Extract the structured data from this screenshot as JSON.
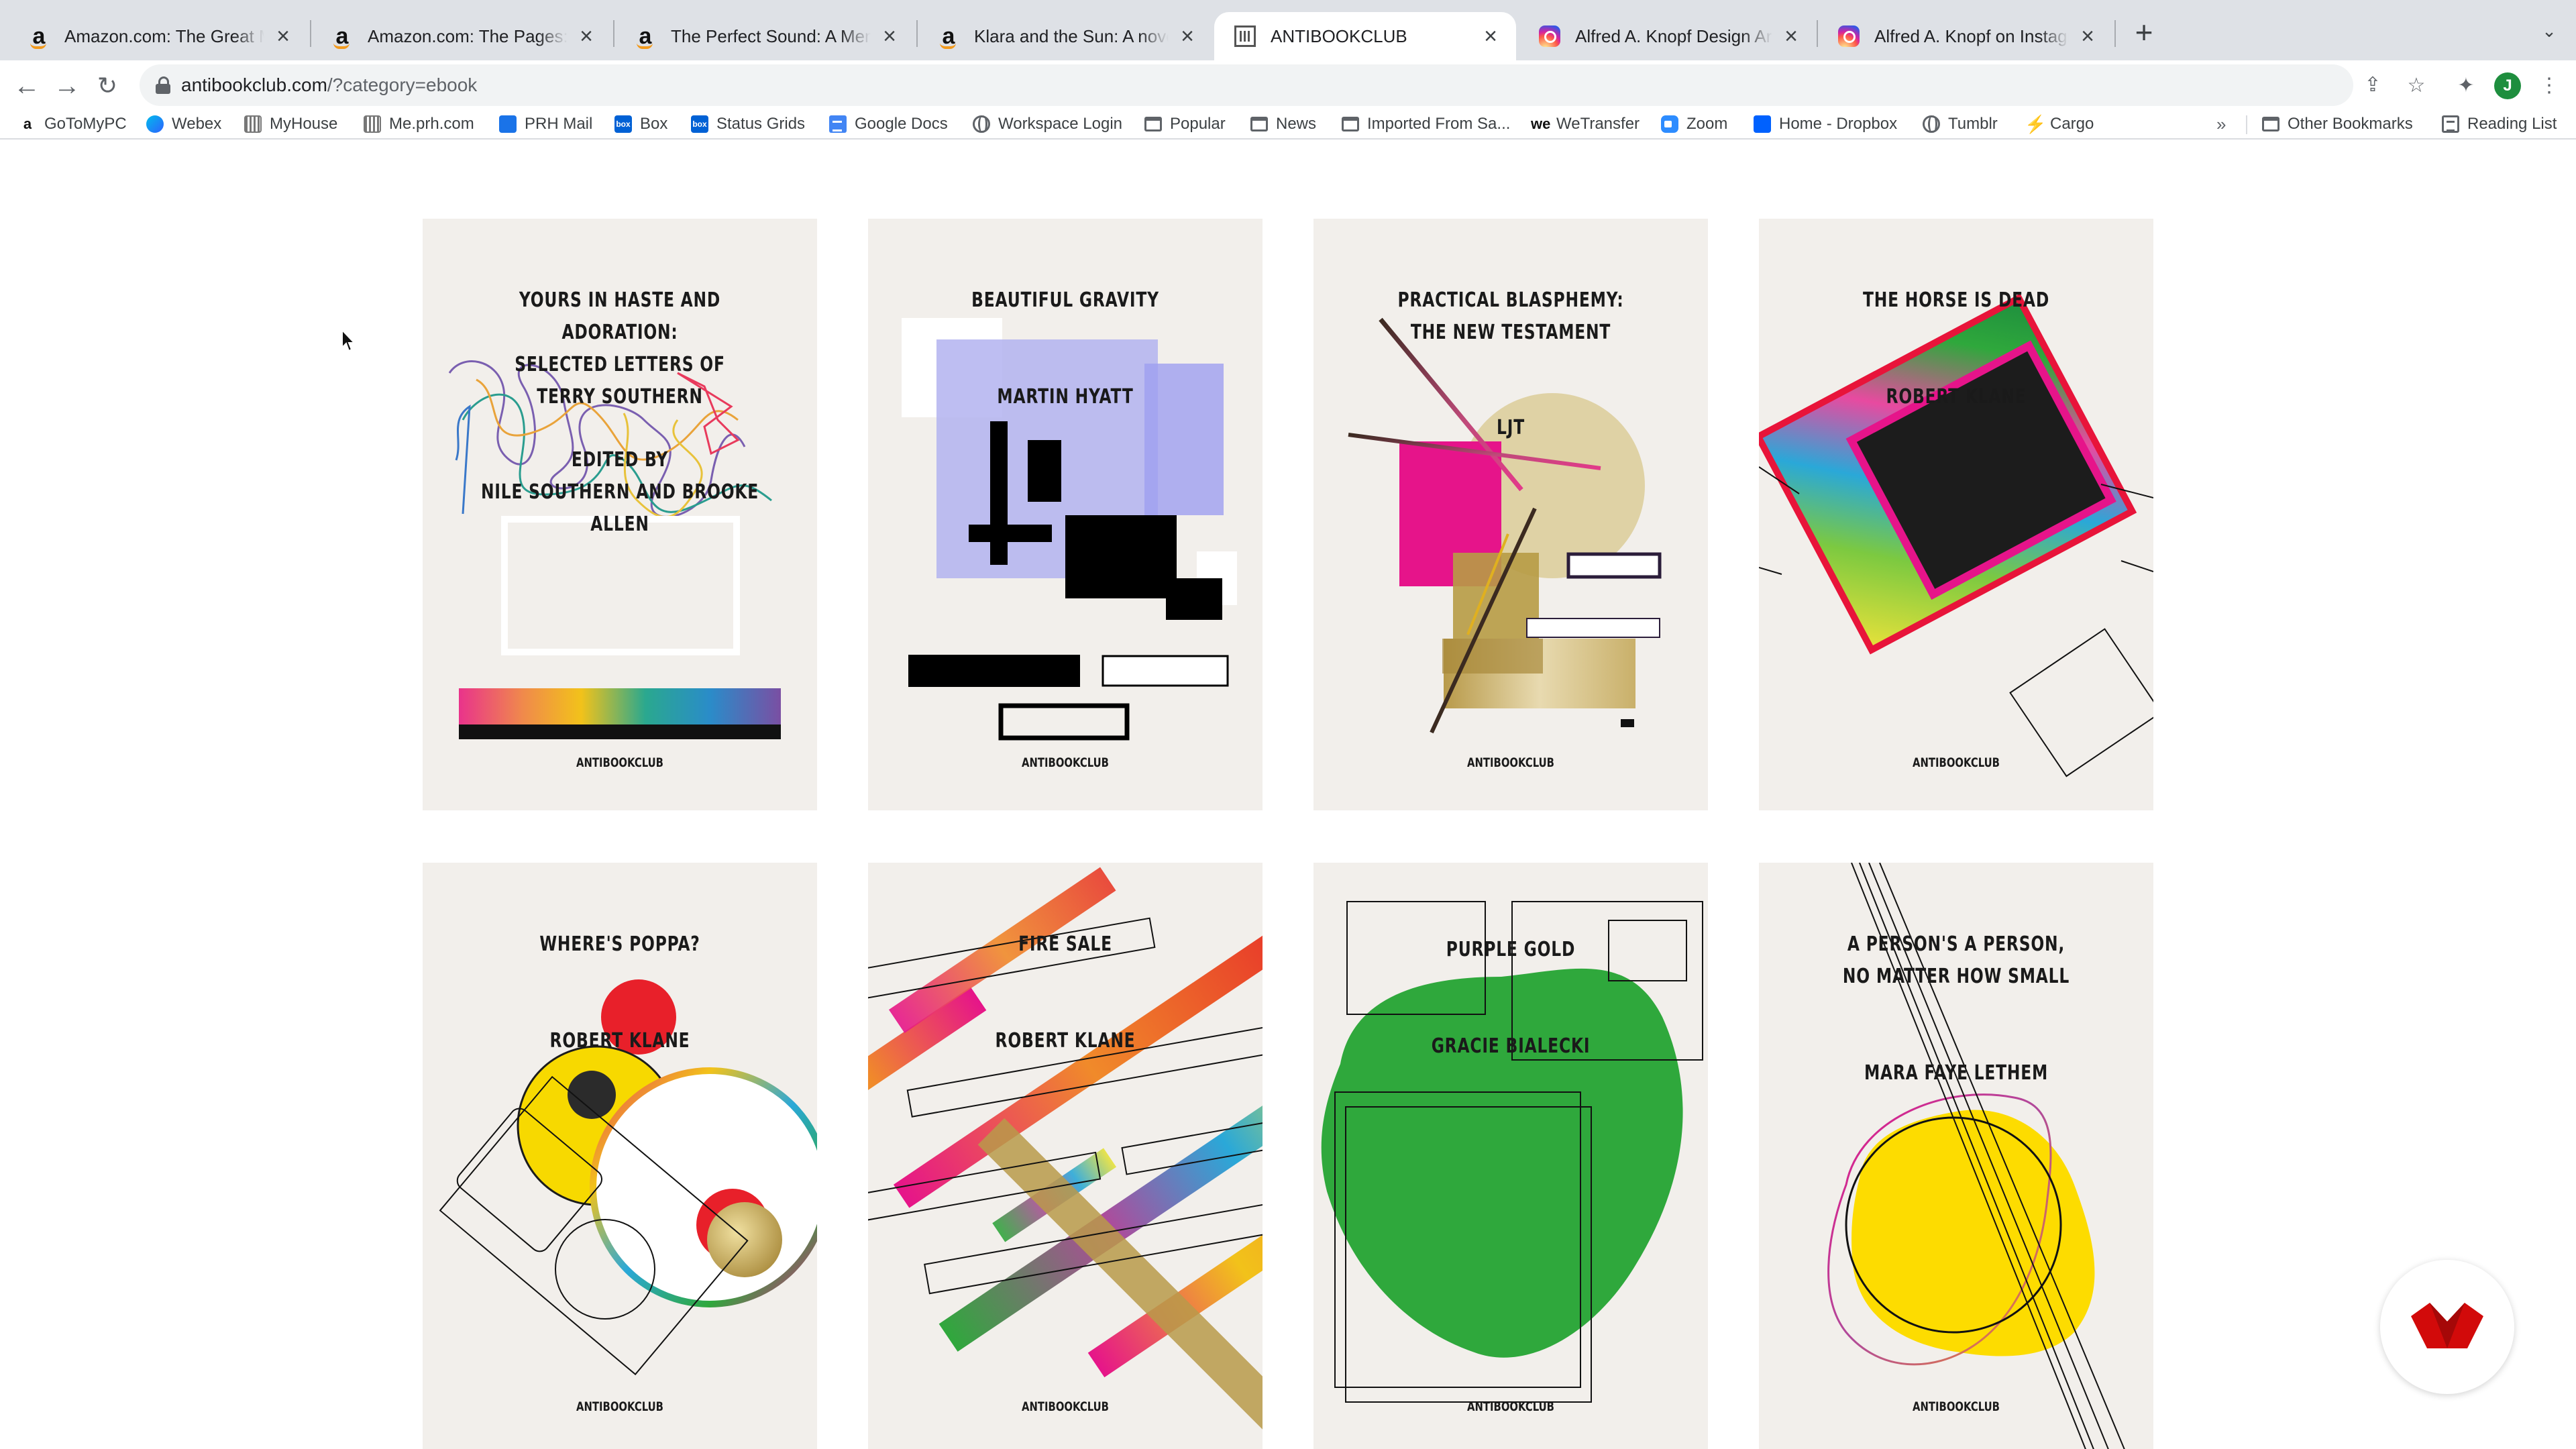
{
  "browser": {
    "tabs": [
      {
        "title": "Amazon.com: The Great Mistake",
        "icon": "amazon-icon",
        "active": false
      },
      {
        "title": "Amazon.com: The Pages: A nov",
        "icon": "amazon-icon",
        "active": false
      },
      {
        "title": "The Perfect Sound: A Memoir",
        "icon": "amazon-icon",
        "active": false
      },
      {
        "title": "Klara and the Sun: A novel: Ish",
        "icon": "amazon-icon",
        "active": false
      },
      {
        "title": "ANTIBOOKCLUB",
        "icon": "grid-icon",
        "active": true
      },
      {
        "title": "Alfred A. Knopf Design Archive",
        "icon": "instagram-icon",
        "active": false
      },
      {
        "title": "Alfred A. Knopf on Instagram: \"",
        "icon": "instagram-icon",
        "active": false
      }
    ],
    "url": {
      "host": "antibookclub.com",
      "path": "/?category=ebook"
    },
    "profile_initial": "J",
    "bookmarks": [
      {
        "label": "GoToMyPC",
        "icon": "globe-icon"
      },
      {
        "label": "Webex",
        "icon": "webex-icon"
      },
      {
        "label": "MyHouse",
        "icon": "grid-icon"
      },
      {
        "label": "Me.prh.com",
        "icon": "grid-icon"
      },
      {
        "label": "PRH Mail",
        "icon": "outlook-icon"
      },
      {
        "label": "Box",
        "icon": "box-icon"
      },
      {
        "label": "Status Grids",
        "icon": "dropbox-icon"
      },
      {
        "label": "Google Docs",
        "icon": "docs-icon"
      },
      {
        "label": "Workspace Login",
        "icon": "globe-icon"
      },
      {
        "label": "Popular",
        "icon": "folder-icon"
      },
      {
        "label": "News",
        "icon": "folder-icon"
      },
      {
        "label": "Imported From Sa...",
        "icon": "folder-icon"
      },
      {
        "label": "WeTransfer",
        "icon": "wetransfer-icon"
      },
      {
        "label": "Zoom",
        "icon": "zoom-icon"
      },
      {
        "label": "Home - Dropbox",
        "icon": "dropbox-icon"
      },
      {
        "label": "Tumblr",
        "icon": "globe-icon"
      },
      {
        "label": "Cargo",
        "icon": "bolt-icon"
      }
    ],
    "bookmarks_overflow": "»",
    "other_bookmarks": "Other Bookmarks",
    "reading_list": "Reading List"
  },
  "books": [
    {
      "title_lines": [
        "YOURS IN HASTE AND ADORATION:",
        "SELECTED LETTERS OF",
        "TERRY SOUTHERN"
      ],
      "author_lines": [
        "EDITED BY",
        "NILE SOUTHERN AND BROOKE ALLEN"
      ],
      "publisher": "ANTIBOOKCLUB"
    },
    {
      "title_lines": [
        "BEAUTIFUL GRAVITY"
      ],
      "author_lines": [
        "MARTIN HYATT"
      ],
      "publisher": "ANTIBOOKCLUB"
    },
    {
      "title_lines": [
        "PRACTICAL BLASPHEMY:",
        "THE NEW TESTAMENT"
      ],
      "author_lines": [
        "LJT"
      ],
      "publisher": "ANTIBOOKCLUB"
    },
    {
      "title_lines": [
        "THE HORSE IS DEAD"
      ],
      "author_lines": [
        "ROBERT KLANE"
      ],
      "publisher": "ANTIBOOKCLUB"
    },
    {
      "title_lines": [
        "WHERE'S POPPA?"
      ],
      "author_lines": [
        "ROBERT KLANE"
      ],
      "publisher": "ANTIBOOKCLUB"
    },
    {
      "title_lines": [
        "FIRE SALE"
      ],
      "author_lines": [
        "ROBERT KLANE"
      ],
      "publisher": "ANTIBOOKCLUB"
    },
    {
      "title_lines": [
        "PURPLE GOLD"
      ],
      "author_lines": [
        "GRACIE BIALECKI"
      ],
      "publisher": "ANTIBOOKCLUB"
    },
    {
      "title_lines": [
        "A PERSON'S A PERSON,",
        "NO MATTER HOW SMALL"
      ],
      "author_lines": [
        "MARA FAYE LETHEM"
      ],
      "publisher": "ANTIBOOKCLUB"
    }
  ],
  "colors": {
    "cover_bg": "#f2efeb",
    "chat_accent": "#d20a0a",
    "green": "#2fa83c",
    "yellow": "#f7d900",
    "magenta": "#e6007e"
  }
}
